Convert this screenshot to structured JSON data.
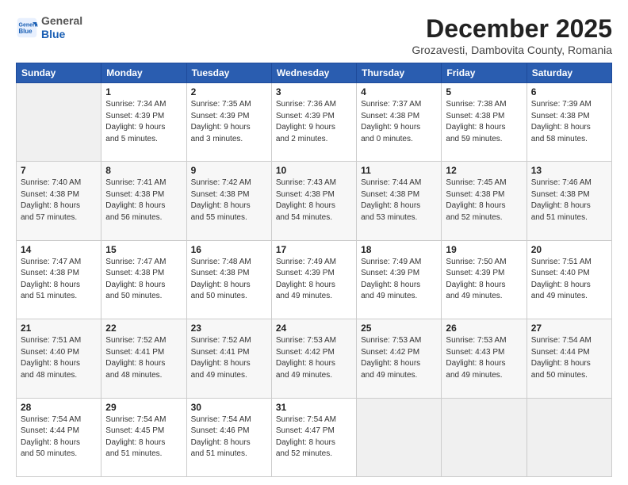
{
  "header": {
    "logo_general": "General",
    "logo_blue": "Blue",
    "month_title": "December 2025",
    "location": "Grozavesti, Dambovita County, Romania"
  },
  "weekdays": [
    "Sunday",
    "Monday",
    "Tuesday",
    "Wednesday",
    "Thursday",
    "Friday",
    "Saturday"
  ],
  "weeks": [
    [
      {
        "day": "",
        "info": ""
      },
      {
        "day": "1",
        "info": "Sunrise: 7:34 AM\nSunset: 4:39 PM\nDaylight: 9 hours\nand 5 minutes."
      },
      {
        "day": "2",
        "info": "Sunrise: 7:35 AM\nSunset: 4:39 PM\nDaylight: 9 hours\nand 3 minutes."
      },
      {
        "day": "3",
        "info": "Sunrise: 7:36 AM\nSunset: 4:39 PM\nDaylight: 9 hours\nand 2 minutes."
      },
      {
        "day": "4",
        "info": "Sunrise: 7:37 AM\nSunset: 4:38 PM\nDaylight: 9 hours\nand 0 minutes."
      },
      {
        "day": "5",
        "info": "Sunrise: 7:38 AM\nSunset: 4:38 PM\nDaylight: 8 hours\nand 59 minutes."
      },
      {
        "day": "6",
        "info": "Sunrise: 7:39 AM\nSunset: 4:38 PM\nDaylight: 8 hours\nand 58 minutes."
      }
    ],
    [
      {
        "day": "7",
        "info": "Sunrise: 7:40 AM\nSunset: 4:38 PM\nDaylight: 8 hours\nand 57 minutes."
      },
      {
        "day": "8",
        "info": "Sunrise: 7:41 AM\nSunset: 4:38 PM\nDaylight: 8 hours\nand 56 minutes."
      },
      {
        "day": "9",
        "info": "Sunrise: 7:42 AM\nSunset: 4:38 PM\nDaylight: 8 hours\nand 55 minutes."
      },
      {
        "day": "10",
        "info": "Sunrise: 7:43 AM\nSunset: 4:38 PM\nDaylight: 8 hours\nand 54 minutes."
      },
      {
        "day": "11",
        "info": "Sunrise: 7:44 AM\nSunset: 4:38 PM\nDaylight: 8 hours\nand 53 minutes."
      },
      {
        "day": "12",
        "info": "Sunrise: 7:45 AM\nSunset: 4:38 PM\nDaylight: 8 hours\nand 52 minutes."
      },
      {
        "day": "13",
        "info": "Sunrise: 7:46 AM\nSunset: 4:38 PM\nDaylight: 8 hours\nand 51 minutes."
      }
    ],
    [
      {
        "day": "14",
        "info": "Sunrise: 7:47 AM\nSunset: 4:38 PM\nDaylight: 8 hours\nand 51 minutes."
      },
      {
        "day": "15",
        "info": "Sunrise: 7:47 AM\nSunset: 4:38 PM\nDaylight: 8 hours\nand 50 minutes."
      },
      {
        "day": "16",
        "info": "Sunrise: 7:48 AM\nSunset: 4:38 PM\nDaylight: 8 hours\nand 50 minutes."
      },
      {
        "day": "17",
        "info": "Sunrise: 7:49 AM\nSunset: 4:39 PM\nDaylight: 8 hours\nand 49 minutes."
      },
      {
        "day": "18",
        "info": "Sunrise: 7:49 AM\nSunset: 4:39 PM\nDaylight: 8 hours\nand 49 minutes."
      },
      {
        "day": "19",
        "info": "Sunrise: 7:50 AM\nSunset: 4:39 PM\nDaylight: 8 hours\nand 49 minutes."
      },
      {
        "day": "20",
        "info": "Sunrise: 7:51 AM\nSunset: 4:40 PM\nDaylight: 8 hours\nand 49 minutes."
      }
    ],
    [
      {
        "day": "21",
        "info": "Sunrise: 7:51 AM\nSunset: 4:40 PM\nDaylight: 8 hours\nand 48 minutes."
      },
      {
        "day": "22",
        "info": "Sunrise: 7:52 AM\nSunset: 4:41 PM\nDaylight: 8 hours\nand 48 minutes."
      },
      {
        "day": "23",
        "info": "Sunrise: 7:52 AM\nSunset: 4:41 PM\nDaylight: 8 hours\nand 49 minutes."
      },
      {
        "day": "24",
        "info": "Sunrise: 7:53 AM\nSunset: 4:42 PM\nDaylight: 8 hours\nand 49 minutes."
      },
      {
        "day": "25",
        "info": "Sunrise: 7:53 AM\nSunset: 4:42 PM\nDaylight: 8 hours\nand 49 minutes."
      },
      {
        "day": "26",
        "info": "Sunrise: 7:53 AM\nSunset: 4:43 PM\nDaylight: 8 hours\nand 49 minutes."
      },
      {
        "day": "27",
        "info": "Sunrise: 7:54 AM\nSunset: 4:44 PM\nDaylight: 8 hours\nand 50 minutes."
      }
    ],
    [
      {
        "day": "28",
        "info": "Sunrise: 7:54 AM\nSunset: 4:44 PM\nDaylight: 8 hours\nand 50 minutes."
      },
      {
        "day": "29",
        "info": "Sunrise: 7:54 AM\nSunset: 4:45 PM\nDaylight: 8 hours\nand 51 minutes."
      },
      {
        "day": "30",
        "info": "Sunrise: 7:54 AM\nSunset: 4:46 PM\nDaylight: 8 hours\nand 51 minutes."
      },
      {
        "day": "31",
        "info": "Sunrise: 7:54 AM\nSunset: 4:47 PM\nDaylight: 8 hours\nand 52 minutes."
      },
      {
        "day": "",
        "info": ""
      },
      {
        "day": "",
        "info": ""
      },
      {
        "day": "",
        "info": ""
      }
    ]
  ]
}
